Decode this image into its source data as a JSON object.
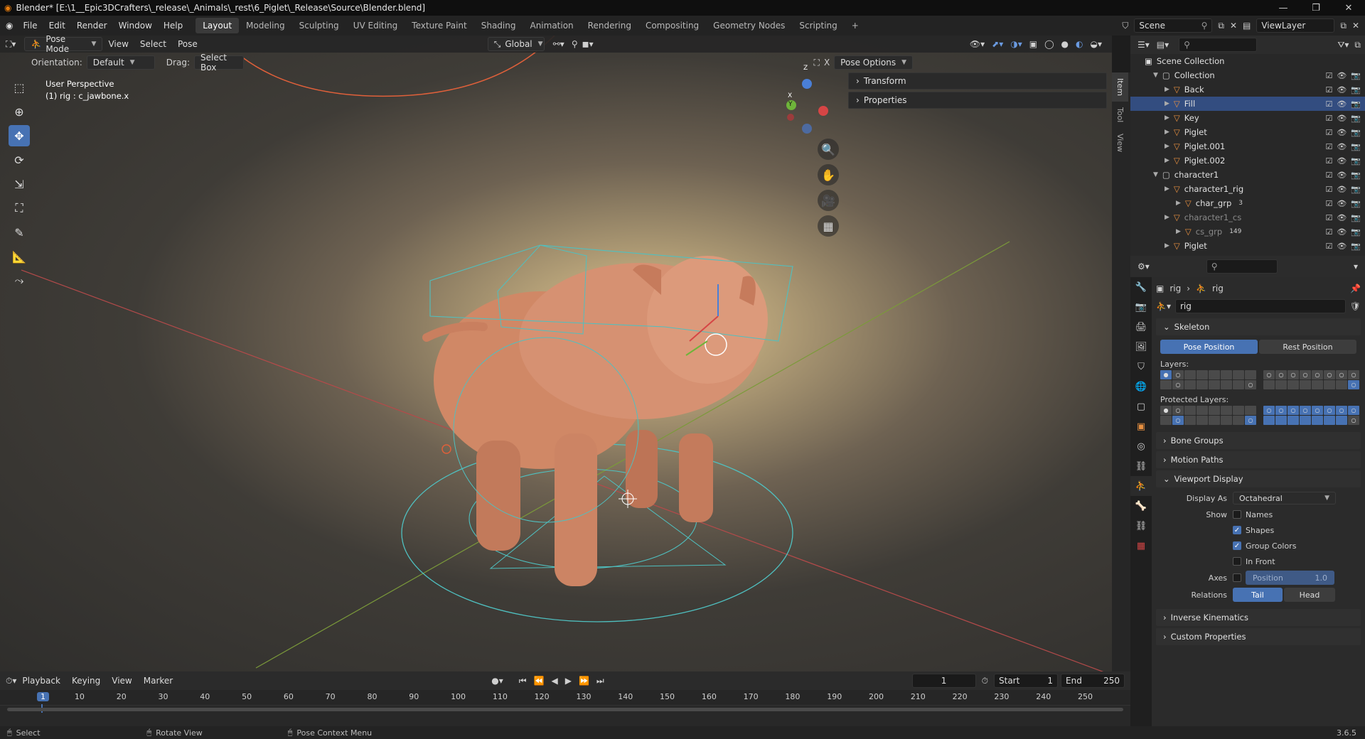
{
  "title": "Blender* [E:\\1__Epic3DCrafters\\_release\\_Animals\\_rest\\6_Piglet\\_Release\\Source\\Blender.blend]",
  "menu": [
    "File",
    "Edit",
    "Render",
    "Window",
    "Help"
  ],
  "workspaces": [
    "Layout",
    "Modeling",
    "Sculpting",
    "UV Editing",
    "Texture Paint",
    "Shading",
    "Animation",
    "Rendering",
    "Compositing",
    "Geometry Nodes",
    "Scripting",
    "+"
  ],
  "scene": "Scene",
  "view_layer": "ViewLayer",
  "viewport": {
    "mode": "Pose Mode",
    "menus": [
      "View",
      "Select",
      "Pose"
    ],
    "transform_orientation": "Global",
    "orientation_label": "Orientation:",
    "orientation_value": "Default",
    "drag_label": "Drag:",
    "drag_value": "Select Box",
    "pose_options": "Pose Options",
    "x_mirror": "X",
    "overlay_line1": "User Perspective",
    "overlay_line2": "(1) rig : c_jawbone.x",
    "gizmo_axes": {
      "z": "Z",
      "y": "Y",
      "x": "X"
    },
    "npanel_sections": [
      "Transform",
      "Properties"
    ],
    "side_tabs": [
      "Item",
      "Tool",
      "View"
    ]
  },
  "outliner": {
    "root": "Scene Collection",
    "rows": [
      {
        "label": "Collection",
        "depth": 0
      },
      {
        "label": "Back",
        "depth": 1
      },
      {
        "label": "Fill",
        "depth": 1,
        "selected": true
      },
      {
        "label": "Key",
        "depth": 1
      },
      {
        "label": "Piglet",
        "depth": 1
      },
      {
        "label": "Piglet.001",
        "depth": 1
      },
      {
        "label": "Piglet.002",
        "depth": 1
      },
      {
        "label": "character1",
        "depth": 0
      },
      {
        "label": "character1_rig",
        "depth": 1
      },
      {
        "label": "char_grp",
        "depth": 2,
        "badge": "3"
      },
      {
        "label": "character1_cs",
        "depth": 1,
        "dim": true
      },
      {
        "label": "cs_grp",
        "depth": 2,
        "dim": true,
        "badge": "149"
      },
      {
        "label": "Piglet",
        "depth": 1
      }
    ]
  },
  "properties": {
    "breadcrumb1": "rig",
    "breadcrumb2": "rig",
    "data_name": "rig",
    "skeleton": "Skeleton",
    "pose_position": "Pose Position",
    "rest_position": "Rest Position",
    "layers": "Layers:",
    "protected_layers": "Protected Layers:",
    "bone_groups": "Bone Groups",
    "motion_paths": "Motion Paths",
    "viewport_display": "Viewport Display",
    "display_as_label": "Display As",
    "display_as_value": "Octahedral",
    "show_label": "Show",
    "show_names": "Names",
    "show_shapes": "Shapes",
    "show_group_colors": "Group Colors",
    "show_in_front": "In Front",
    "axes_label": "Axes",
    "axes_position": "Position",
    "axes_value": "1.0",
    "relations_label": "Relations",
    "relations_tail": "Tail",
    "relations_head": "Head",
    "inverse_kinematics": "Inverse Kinematics",
    "custom_properties": "Custom Properties"
  },
  "timeline": {
    "menus": [
      "Playback",
      "Keying",
      "View",
      "Marker"
    ],
    "current_frame": "1",
    "start_label": "Start",
    "start": "1",
    "end_label": "End",
    "end": "250",
    "ticks": [
      "1",
      "10",
      "20",
      "30",
      "40",
      "50",
      "60",
      "70",
      "80",
      "90",
      "100",
      "110",
      "120",
      "130",
      "140",
      "150",
      "160",
      "170",
      "180",
      "190",
      "200",
      "210",
      "220",
      "230",
      "240",
      "250"
    ]
  },
  "status": {
    "select": "Select",
    "rotate_view": "Rotate View",
    "context_menu": "Pose Context Menu",
    "version": "3.6.5"
  },
  "colors": {
    "accent": "#4772b3",
    "selection": "#334d80",
    "rig_lines": "#4fc0c0",
    "pig": "#d98d6a"
  }
}
